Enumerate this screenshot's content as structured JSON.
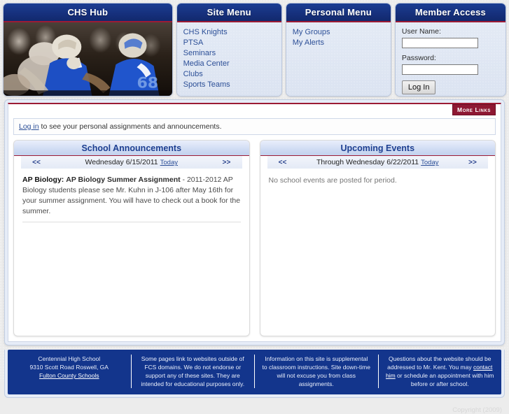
{
  "top_panels": {
    "hub": {
      "title": "CHS Hub",
      "photo_alt": "football-action-photo"
    },
    "site_menu": {
      "title": "Site Menu",
      "items": [
        {
          "label": "CHS Knights"
        },
        {
          "label": "PTSA"
        },
        {
          "label": "Seminars"
        },
        {
          "label": "Media Center"
        },
        {
          "label": "Clubs"
        },
        {
          "label": "Sports Teams"
        }
      ]
    },
    "personal_menu": {
      "title": "Personal Menu",
      "items": [
        {
          "label": "My Groups"
        },
        {
          "label": "My Alerts"
        }
      ]
    },
    "member_access": {
      "title": "Member Access",
      "username_label": "User Name:",
      "username_value": "",
      "password_label": "Password:",
      "password_value": "",
      "login_button": "Log In"
    }
  },
  "main": {
    "more_links_label": "More Links",
    "login_notice": {
      "link_text": "Log in",
      "rest_text": " to see your personal assignments and announcements."
    },
    "announcements": {
      "title": "School Announcements",
      "prev_label": "<<",
      "next_label": ">>",
      "date_text": "Wednesday 6/15/2011",
      "today_label": "Today",
      "items": [
        {
          "course": "AP Biology:",
          "title": "AP Biology Summer Assignment",
          "body": " - 2011-2012 AP Biology students please see Mr. Kuhn in J-106 after May 16th for your summer assignment. You will have to check out a book for the summer."
        }
      ]
    },
    "events": {
      "title": "Upcoming Events",
      "prev_label": "<<",
      "next_label": ">>",
      "date_text": "Through Wednesday 6/22/2011",
      "today_label": "Today",
      "empty_message": "No school events are posted for period."
    }
  },
  "footer": {
    "columns": [
      {
        "line1": "Centennial High School",
        "line2": "9310 Scott Road Roswell, GA",
        "link": "Fulton County Schools"
      },
      {
        "text": "Some pages link to websites outside of FCS domains. We do not endorse or support any of these sites. They are intended for educational purposes only."
      },
      {
        "text": "Information on this site is supplemental to classroom instructions. Site down-time will not excuse you from class assignments."
      },
      {
        "pre": "Questions about the website should be addressed to Mr. Kent. You may ",
        "link": "contact him",
        "post": " or schedule an appointment with him before or after school."
      }
    ],
    "copyright": "Copyright (2009)"
  },
  "colors": {
    "header_blue": "#16307c",
    "accent_maroon": "#9c1b35",
    "footer_blue": "#13358c",
    "link_blue": "#2c4f97"
  }
}
